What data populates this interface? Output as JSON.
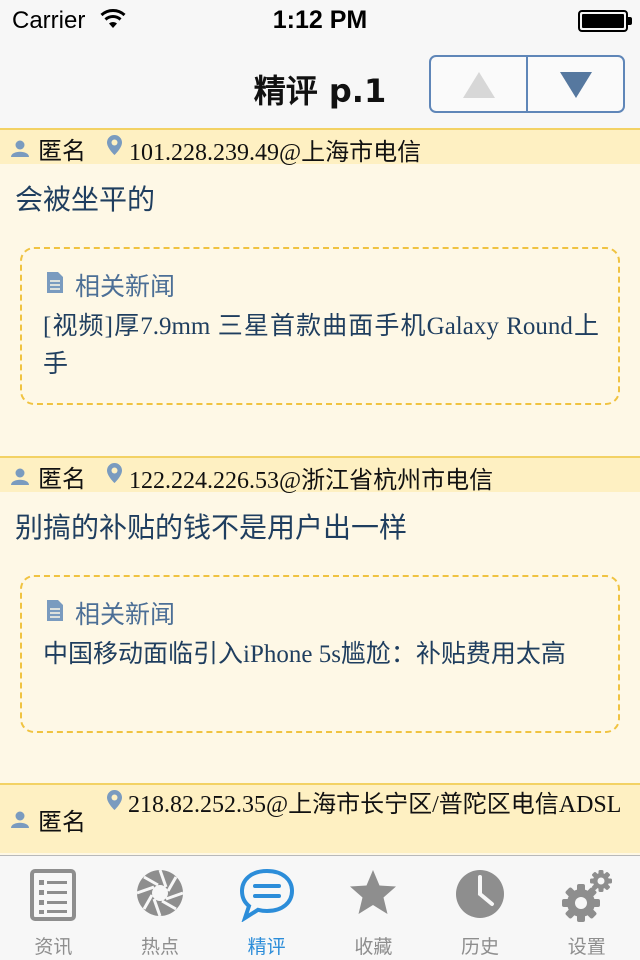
{
  "status_bar": {
    "carrier": "Carrier",
    "time": "1:12 PM"
  },
  "nav": {
    "title": "精评 p.1",
    "prev_icon": "triangle-up-icon",
    "next_icon": "triangle-down-icon"
  },
  "comments": [
    {
      "user": "匿名",
      "location": "101.228.239.49@上海市电信",
      "text": "会被坐平的",
      "news_label": "相关新闻",
      "news_title": "[视频]厚7.9mm 三星首款曲面手机Galaxy Round上手"
    },
    {
      "user": "匿名",
      "location": "122.224.226.53@浙江省杭州市电信",
      "text": "别搞的补贴的钱不是用户出一样",
      "news_label": "相关新闻",
      "news_title": "中国移动面临引入iPhone 5s尴尬：补贴费用太高"
    },
    {
      "user": "匿名",
      "location": "218.82.252.35@上海市长宁区/普陀区电信ADSL"
    }
  ],
  "tabs": [
    {
      "label": "资讯",
      "icon": "news-list-icon",
      "active": false
    },
    {
      "label": "热点",
      "icon": "aperture-icon",
      "active": false
    },
    {
      "label": "精评",
      "icon": "speech-bubble-icon",
      "active": true
    },
    {
      "label": "收藏",
      "icon": "star-icon",
      "active": false
    },
    {
      "label": "历史",
      "icon": "clock-icon",
      "active": false
    },
    {
      "label": "设置",
      "icon": "gears-icon",
      "active": false
    }
  ],
  "colors": {
    "accent": "#2c8dd9",
    "comment_header_bg": "#fef0c2",
    "comment_body_bg": "#fef8e6",
    "news_border": "#f0c341",
    "text_blue": "#1f3e5f"
  }
}
